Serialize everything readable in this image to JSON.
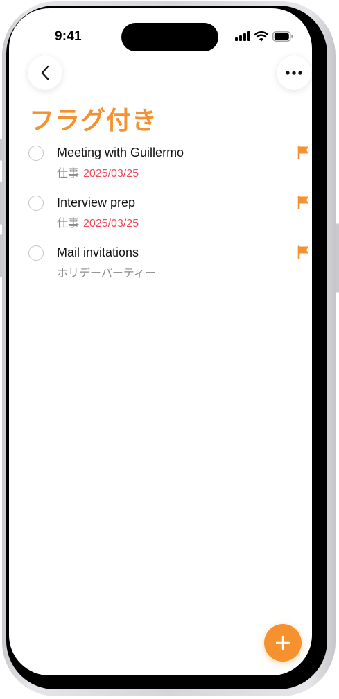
{
  "status_bar": {
    "time": "9:41"
  },
  "navigation": {
    "back_icon": "chevron-left-icon",
    "more_icon": "ellipsis-icon"
  },
  "page": {
    "title": "フラグ付き",
    "accent_color": "#F5922F",
    "date_color": "#F2485B"
  },
  "tasks": [
    {
      "title": "Meeting with Guillermo",
      "list": "仕事",
      "date": "2025/03/25",
      "flagged": true
    },
    {
      "title": "Interview prep",
      "list": "仕事",
      "date": "2025/03/25",
      "flagged": true
    },
    {
      "title": "Mail invitations",
      "list": "ホリデーパーティー",
      "date": "",
      "flagged": true
    }
  ],
  "fab": {
    "icon": "plus-icon"
  }
}
